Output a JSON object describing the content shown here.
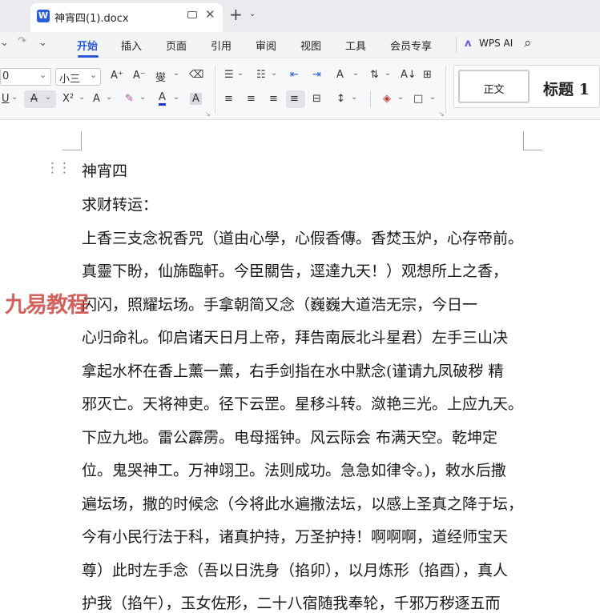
{
  "titlebar": {
    "doc_title": "神宵四(1).docx",
    "app_icon_letter": "W",
    "close_glyph": "✕",
    "new_tab_glyph": "+",
    "new_tab_menu_glyph": "⌄"
  },
  "quickaccess": {
    "redo_glyph": "↷",
    "more_glyph": "⌄"
  },
  "menu": {
    "items": [
      "开始",
      "插入",
      "页面",
      "引用",
      "审阅",
      "视图",
      "工具",
      "会员专享"
    ],
    "wps_ai": "WPS AI",
    "search_glyph": "⌕"
  },
  "ribbon": {
    "font_name_value": "0",
    "font_size_value": "小三",
    "grow_font": "A⁺",
    "shrink_font": "A⁻",
    "pinyin": "燮",
    "clear_format": "⌫",
    "underline": "U",
    "strikethrough": "A",
    "superscript": "X²",
    "text_effect": "A",
    "highlight": "✎",
    "font_color": "A",
    "char_shading": "A",
    "bullets": "☰",
    "numbering": "☷",
    "indent_dec": "⇤",
    "indent_inc": "⇥",
    "text_direction": "A",
    "sort": "⇅",
    "chinese_layout": "A↓",
    "table_grid": "⊞",
    "align_left": "≡",
    "align_center": "≡",
    "align_right": "≡",
    "justify": "≡",
    "distribute": "⊟",
    "line_spacing": "↕",
    "shading": "◈",
    "border": "□",
    "style_normal": "正文",
    "style_heading1": "标题 1"
  },
  "document": {
    "watermark": "九易教程",
    "lines": [
      "神宵四",
      "求财转运：",
      "上香三支念祝香咒（道由心學，心假香傳。香焚玉炉，心存帝前。",
      "真靈下盼，仙旆臨軒。今臣關告，逕達九天！）观想所上之香，",
      "   闪闪，照耀坛场。手拿朝简又念（巍巍大道浩无宗，今日一",
      "心归命礼。仰启诸天日月上帝，拜告南辰北斗星君）左手三山决",
      "拿起水杯在香上薰一薰，右手剑指在水中默念(谨请九凤破秽 精",
      "邪灭亡。天将神吏。径下云罡。星移斗转。潋艳三光。上应九天。",
      "下应九地。雷公霹雳。电母摇钟。风云际会 布满天空。乾坤定",
      "位。鬼哭神工。万神翊卫。法则成功。急急如律令。)，敕水后撒",
      "遍坛场，撒的时候念（今将此水遍撒法坛，以感上圣真之降于坛，",
      "今有小民行法于科，诸真护持，万圣护持！啊啊啊，道经师宝天",
      "尊）此时左手念（吾以日洗身（掐卯），以月炼形（掐酉），真人",
      "护我（掐午），玉女佐形，二十八宿随我奉轮，千邪万秽逐五而"
    ]
  }
}
